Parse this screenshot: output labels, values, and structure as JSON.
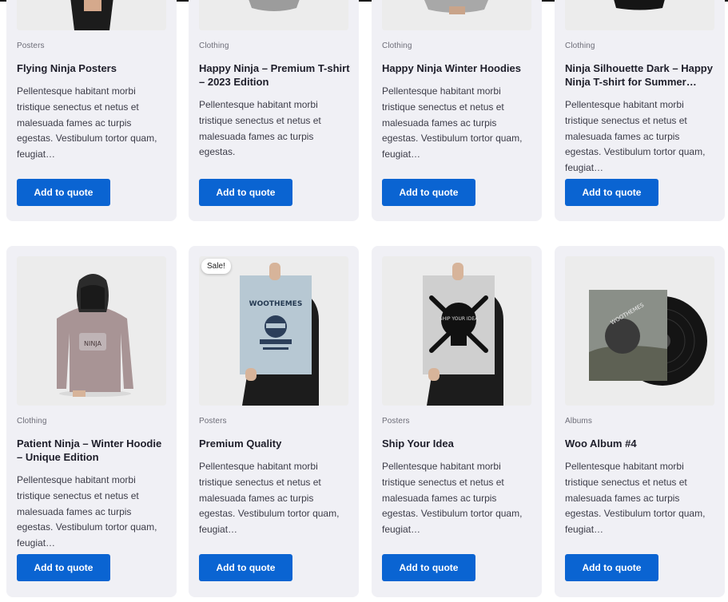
{
  "row1": [
    {
      "category": "Posters",
      "title": "Flying Ninja Posters",
      "description": "Pellentesque habitant morbi tristique senectus et netus et malesuada fames ac turpis egestas. Vestibulum tortor quam, feugiat…",
      "button": "Add to quote"
    },
    {
      "category": "Clothing",
      "title": "Happy Ninja – Premium T-shirt – 2023 Edition",
      "description": "Pellentesque habitant morbi tristique senectus et netus et malesuada fames ac turpis egestas.",
      "button": "Add to quote"
    },
    {
      "category": "Clothing",
      "title": "Happy Ninja Winter Hoodies",
      "description": "Pellentesque habitant morbi tristique senectus et netus et malesuada fames ac turpis egestas. Vestibulum tortor quam, feugiat…",
      "button": "Add to quote"
    },
    {
      "category": "Clothing",
      "title": "Ninja Silhouette Dark – Happy Ninja T-shirt for Summer…",
      "description": "Pellentesque habitant morbi tristique senectus et netus et malesuada fames ac turpis egestas. Vestibulum tortor quam, feugiat…",
      "button": "Add to quote"
    }
  ],
  "row2": [
    {
      "category": "Clothing",
      "title": "Patient Ninja – Winter Hoodie – Unique Edition",
      "description": "Pellentesque habitant morbi tristique senectus et netus et malesuada fames ac turpis egestas. Vestibulum tortor quam, feugiat…",
      "button": "Add to quote",
      "image_text": "NINJA"
    },
    {
      "category": "Posters",
      "title": "Premium Quality",
      "description": "Pellentesque habitant morbi tristique senectus et netus et malesuada fames ac turpis egestas. Vestibulum tortor quam, feugiat…",
      "button": "Add to quote",
      "badge": "Sale!",
      "image_text": "WOOTHEMES"
    },
    {
      "category": "Posters",
      "title": "Ship Your Idea",
      "description": "Pellentesque habitant morbi tristique senectus et netus et malesuada fames ac turpis egestas. Vestibulum tortor quam, feugiat…",
      "button": "Add to quote",
      "image_text": "SHIP YOUR IDEA"
    },
    {
      "category": "Albums",
      "title": "Woo Album #4",
      "description": "Pellentesque habitant morbi tristique senectus et netus et malesuada fames ac turpis egestas. Vestibulum tortor quam, feugiat…",
      "button": "Add to quote",
      "image_text": "WOOTHEMES"
    }
  ],
  "colors": {
    "button": "#0a64d2",
    "card": "#f0f0f5"
  },
  "icons": [
    "hoodie-image",
    "poster-image",
    "skull-poster-image",
    "vinyl-album-image"
  ]
}
